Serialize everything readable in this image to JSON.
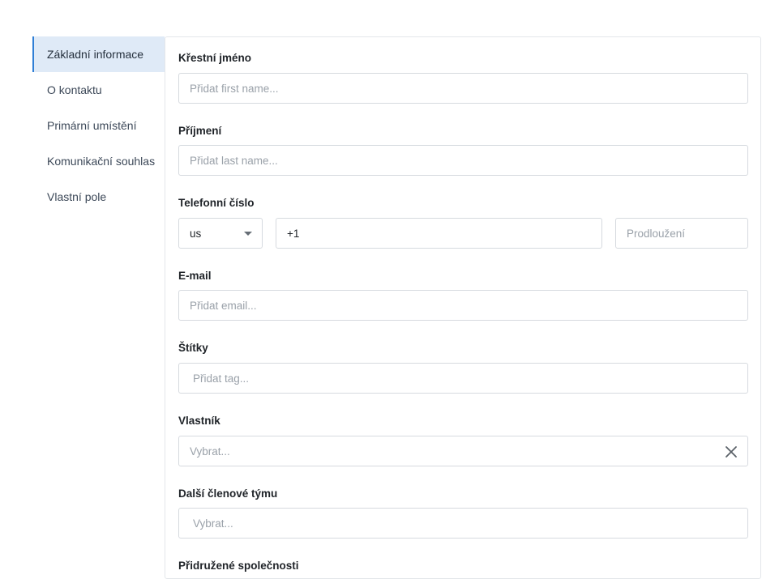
{
  "sidebar": {
    "items": [
      {
        "label": "Základní informace"
      },
      {
        "label": "O kontaktu"
      },
      {
        "label": "Primární umístění"
      },
      {
        "label": "Komunikační souhlas"
      },
      {
        "label": "Vlastní pole"
      }
    ]
  },
  "form": {
    "first_name": {
      "label": "Křestní jméno",
      "placeholder": "Přidat first name..."
    },
    "last_name": {
      "label": "Příjmení",
      "placeholder": "Přidat last name..."
    },
    "phone": {
      "label": "Telefonní číslo",
      "country": "us",
      "number": "+1",
      "extension_placeholder": "Prodloužení"
    },
    "email": {
      "label": "E-mail",
      "placeholder": "Přidat email..."
    },
    "tags": {
      "label": "Štítky",
      "placeholder": "Přidat tag..."
    },
    "owner": {
      "label": "Vlastník",
      "placeholder": "Vybrat..."
    },
    "team_members": {
      "label": "Další členové týmu",
      "placeholder": "Vybrat..."
    },
    "companies": {
      "label": "Přidružené společnosti"
    }
  },
  "colors": {
    "accent": "#2f7fd6",
    "active_bg": "#dfeaf7",
    "border": "#d6dadf"
  },
  "icons": {
    "select_caret": "caret-down-icon",
    "owner_clear": "close-icon"
  }
}
